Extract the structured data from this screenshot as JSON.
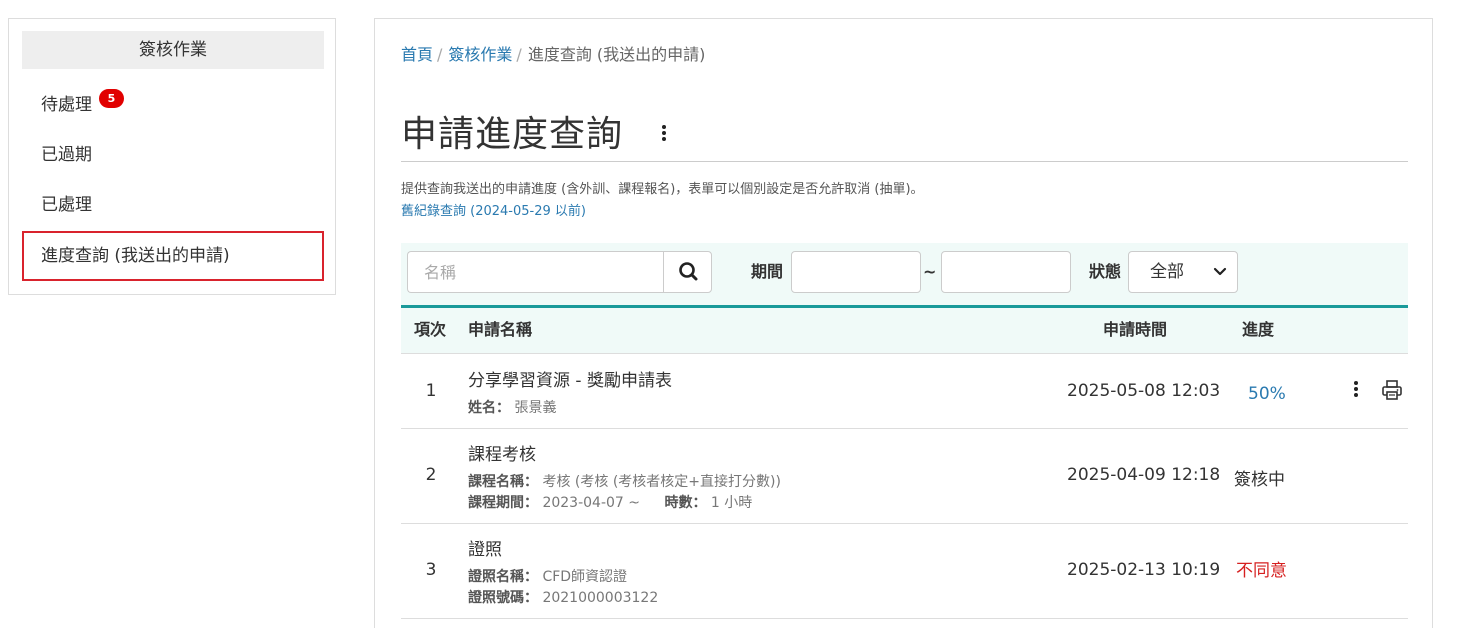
{
  "sidebar": {
    "header": "簽核作業",
    "items": [
      {
        "label": "待處理",
        "badge": "5"
      },
      {
        "label": "已過期"
      },
      {
        "label": "已處理"
      },
      {
        "label": "進度查詢 (我送出的申請)"
      }
    ]
  },
  "breadcrumb": {
    "home": "首頁",
    "section": "簽核作業",
    "current": "進度查詢 (我送出的申請)",
    "separator": "/"
  },
  "page": {
    "title": "申請進度查詢",
    "description": "提供查詢我送出的申請進度 (含外訓、課程報名)，表單可以個別設定是否允許取消 (抽單)。",
    "old_records_link": "舊紀錄查詢 (2024-05-29 以前)"
  },
  "filter": {
    "search_placeholder": "名稱",
    "period_label": "期間",
    "tilde": "~",
    "status_label": "狀態",
    "status_value": "全部"
  },
  "table": {
    "headers": {
      "index": "項次",
      "name": "申請名稱",
      "time": "申請時間",
      "progress": "進度"
    },
    "rows": [
      {
        "index": "1",
        "name": "分享學習資源 - 獎勵申請表",
        "sub1_label": "姓名：",
        "sub1_value": "張景義",
        "time": "2025-05-08 12:03",
        "progress": "50%",
        "progress_color": "#2a7ab0"
      },
      {
        "index": "2",
        "name": "課程考核",
        "sub1_label": "課程名稱：",
        "sub1_value": "考核 (考核 (考核者核定+直接打分數))",
        "sub2_label": "課程期間：",
        "sub2_value": "2023-04-07 ~",
        "sub2b_label": "時數：",
        "sub2b_value": "1 小時",
        "time": "2025-04-09 12:18",
        "progress": "簽核中",
        "progress_color": "#333333"
      },
      {
        "index": "3",
        "name": "證照",
        "sub1_label": "證照名稱：",
        "sub1_value": "CFD師資認證",
        "sub2_label": "證照號碼：",
        "sub2_value": "2021000003122",
        "time": "2025-02-13 10:19",
        "progress": "不同意",
        "progress_color": "#d62020"
      }
    ]
  },
  "colors": {
    "accent": "#1a9a9a",
    "link": "#2a7ab0",
    "badge": "#e10000",
    "active_border": "#d9232d"
  },
  "icons": [
    "search-icon",
    "kebab-menu-icon",
    "print-icon",
    "chevron-down-icon"
  ]
}
